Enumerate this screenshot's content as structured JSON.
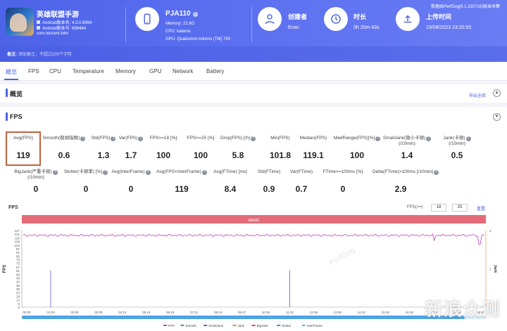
{
  "app": {
    "name": "英雄联盟手游",
    "android_version": "Android版本名: 4.3.0.6994",
    "android_code": "Android版本号: 699464",
    "package": "com.tencent.lolm"
  },
  "device": {
    "name": "PJA110",
    "memory": "Memory: 22.6G",
    "cpu": "CPU: kalama",
    "gpu": "GPU: Qualcomm Adreno (TM) 740"
  },
  "creator": {
    "label": "创建者",
    "value": "Evan"
  },
  "duration": {
    "label": "时长",
    "value": "0h 20m 43s"
  },
  "upload": {
    "label": "上传时间",
    "value": "19/08/2023 23:20:55",
    "perfdog": "数据由PerfDog(9.1.230716)版本收集"
  },
  "note": {
    "label": "备注:",
    "placeholder": "添加备注，不超过200个字符"
  },
  "tabs": [
    "概览",
    "FPS",
    "CPU",
    "Temperature",
    "Memory",
    "GPU",
    "Network",
    "Battery"
  ],
  "overview": {
    "title": "概览",
    "export": "导出全部"
  },
  "fps_section": {
    "title": "FPS"
  },
  "stats_row1": [
    {
      "label": "Avg(FPS)",
      "value": "119",
      "help": false
    },
    {
      "label": "Smooth(稳帧指数)",
      "value": "0.6",
      "help": true
    },
    {
      "label": "Std(FPS)",
      "value": "1.3",
      "help": true
    },
    {
      "label": "Var(FPS)",
      "value": "1.7",
      "help": true
    },
    {
      "label": "FPS>=18 [%]",
      "value": "100",
      "help": false
    },
    {
      "label": "FPS>=25 [%]",
      "value": "100",
      "help": false
    },
    {
      "label": "Drop(FPS) [/h]",
      "value": "5.8",
      "help": true
    },
    {
      "label": "Min(FPS)",
      "value": "101.8",
      "help": false
    },
    {
      "label": "Median(FPS)",
      "value": "119.1",
      "help": false
    },
    {
      "label": "MedRange(FPS)[%]",
      "value": "100",
      "help": true
    },
    {
      "label": "SmallJank(微小卡顿)",
      "label2": "(/10min)",
      "value": "1.4",
      "help": true
    },
    {
      "label": "Jank(卡顿)",
      "label2": "(/10min)",
      "value": "0.5",
      "help": true
    }
  ],
  "stats_row2": [
    {
      "label": "BigJank(严重卡顿)",
      "label2": "(/10min)",
      "value": "0",
      "help": true
    },
    {
      "label": "Stutter(卡顿率) [%]",
      "value": "0",
      "help": true
    },
    {
      "label": "Avg(InterFrame)",
      "value": "0",
      "help": true
    },
    {
      "label": "Avg(FPS+InterFrame)",
      "value": "119",
      "help": true
    },
    {
      "label": "Avg(FTime) [ms]",
      "value": "8.4",
      "help": false
    },
    {
      "label": "Std(FTime)",
      "value": "0.9",
      "help": false
    },
    {
      "label": "Var(FTime)",
      "value": "0.7",
      "help": false
    },
    {
      "label": "FTime>=100ms [%]",
      "value": "0",
      "help": false
    },
    {
      "label": "Delta(FTime)>100ms [/10min]",
      "value": "2.9",
      "help": true
    }
  ],
  "chart_controls": {
    "title": "FPS",
    "fps_ge_label": "FPS(>=)",
    "min1": "18",
    "min2": "25",
    "reset": "重置",
    "label_bar": "label1"
  },
  "chart_data": {
    "type": "line",
    "ylabel": "FPS",
    "y2label": "Jank",
    "y_ticks": [
      "0",
      "6",
      "12",
      "18",
      "24",
      "30",
      "36",
      "42",
      "49",
      "55",
      "61",
      "67",
      "73",
      "79",
      "85",
      "91",
      "97",
      "103",
      "109",
      "115",
      "121",
      "127"
    ],
    "y2_ticks": [
      "0",
      "1",
      "2"
    ],
    "x_ticks": [
      "00:00",
      "01:03",
      "02:06",
      "03:09",
      "04:12",
      "05:15",
      "06:18",
      "07:21",
      "08:24",
      "09:27",
      "10:30",
      "11:33",
      "12:36",
      "13:39",
      "14:42",
      "15:45",
      "16:48",
      "17:51",
      "18:54",
      "19:57"
    ],
    "ylim": [
      0,
      127
    ],
    "series_fps_level": 119,
    "dips": [
      {
        "x": "17:54",
        "y": 110
      },
      {
        "x": "19:54",
        "y": 104
      }
    ],
    "spikes": [
      {
        "x": "01:03",
        "y": 61
      },
      {
        "x": "11:33",
        "y": 61
      }
    ],
    "legend": [
      "FPS",
      "Smooth",
      "SmallJank",
      "Jank",
      "BigJank",
      "Stutter",
      "InterFrame"
    ],
    "legend_colors": [
      "#c23fbf",
      "#3fae5b",
      "#5b5fcf",
      "#e38a2e",
      "#d9434d",
      "#3a8fd9",
      "#49c3d8"
    ],
    "watermark": "PerfDog"
  },
  "watermark_text": "新浪众测"
}
